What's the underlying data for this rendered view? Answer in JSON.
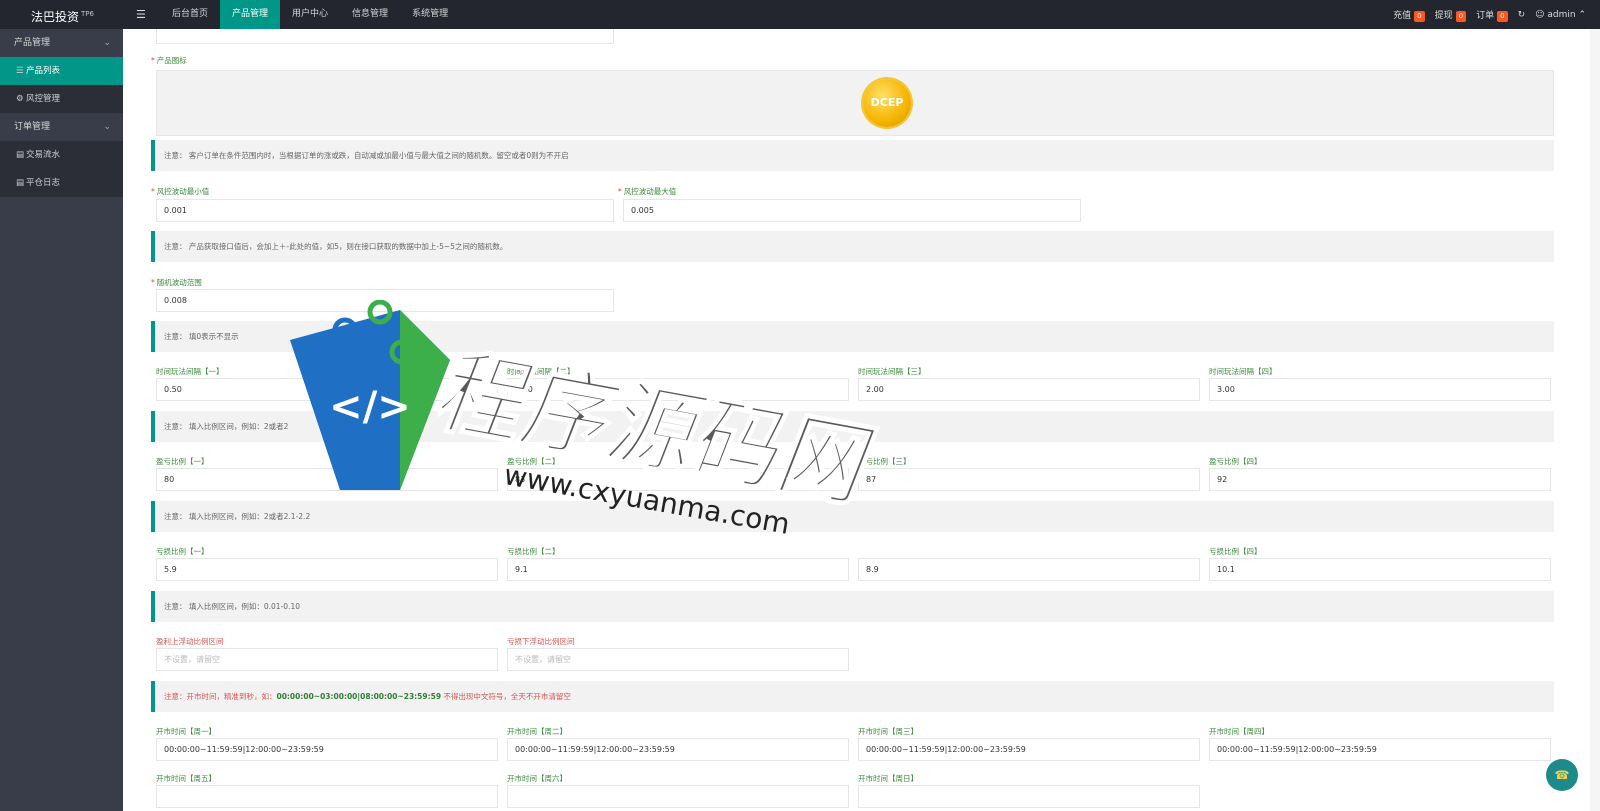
{
  "brand": {
    "name": "法巴投资",
    "version": "TP6"
  },
  "topnav": {
    "menu_icon": "hamburger-icon",
    "items": [
      "后台首页",
      "产品管理",
      "用户中心",
      "信息管理",
      "系统管理"
    ],
    "active_index": 1
  },
  "topright": {
    "recharge": "充值",
    "recharge_count": "0",
    "withdraw": "提现",
    "withdraw_count": "0",
    "order": "订单",
    "order_count": "0",
    "refresh_icon": "refresh-icon",
    "user": "admin"
  },
  "sidebar": {
    "groups": [
      {
        "label": "产品管理",
        "items": [
          {
            "label": "产品列表",
            "active": true
          },
          {
            "label": "风控管理",
            "active": false
          }
        ]
      },
      {
        "label": "订单管理",
        "items": [
          {
            "label": "交易流水",
            "active": false
          },
          {
            "label": "平仓日志",
            "active": false
          }
        ]
      }
    ]
  },
  "form": {
    "product_icon_label": "产品图标",
    "product_icon_text": "DCEP",
    "note1": "注意：  客户订单在条件范围内时，当根据订单的涨或跌，自动减或加最小值与最大值之间的随机数。留空或者0则为不开启",
    "risk_min_label": "风控波动最小值",
    "risk_min_value": "0.001",
    "risk_max_label": "风控波动最大值",
    "risk_max_value": "0.005",
    "note2": "注意：  产品获取接口值后，会加上＋-此处的值，如5，则在接口获取的数据中加上-5~5之间的随机数。",
    "random_label": "随机波动范围",
    "random_value": "0.008",
    "note3": "注意：  填0表示不显示",
    "interval_labels": [
      "时间玩法间隔【一】",
      "时间玩法间隔【二】",
      "时间玩法间隔【三】",
      "时间玩法间隔【四】"
    ],
    "interval_values": [
      "0.50",
      "1.00",
      "2.00",
      "3.00"
    ],
    "note4": "注意：  填入比例区间，例如：2或者2",
    "profit_labels": [
      "盈亏比例【一】",
      "盈亏比例【二】",
      "盈亏比例【三】",
      "盈亏比例【四】"
    ],
    "profit_values": [
      "80",
      "83",
      "87",
      "92"
    ],
    "note5": "注意：  填入比例区间，例如：2或者2.1-2.2",
    "loss_labels": [
      "亏损比例【一】",
      "亏损比例【二】",
      "亏损比例【三】",
      "亏损比例【四】"
    ],
    "loss_values": [
      "5.9",
      "9.1",
      "8.9",
      "10.1"
    ],
    "note6": "注意：  填入比例区间，例如：0.01-0.10",
    "float_up_label": "盈利上浮动比例区间",
    "float_up_placeholder": "不设置，请留空",
    "float_down_label": "亏损下浮动比例区间",
    "float_down_placeholder": "不设置，请留空",
    "note7_prefix": "注意：开市时间，精准到秒，如：",
    "note7_example": "00:00:00~03:00:00|08:00:00~23:59:59",
    "note7_suffix": " 不得出现中文符号，全天不开市请留空",
    "open_labels_row1": [
      "开市时间【周一】",
      "开市时间【周二】",
      "开市时间【周三】",
      "开市时间【周四】"
    ],
    "open_values_row1": [
      "00:00:00~11:59:59|12:00:00~23:59:59",
      "00:00:00~11:59:59|12:00:00~23:59:59",
      "00:00:00~11:59:59|12:00:00~23:59:59",
      "00:00:00~11:59:59|12:00:00~23:59:59"
    ],
    "open_labels_row2": [
      "开市时间【周五】",
      "开市时间【周六】",
      "开市时间【周日】"
    ]
  },
  "watermark": {
    "title": "程序源码网",
    "url": "www.cxyuanma.com"
  },
  "fab_icon": "headset-icon"
}
